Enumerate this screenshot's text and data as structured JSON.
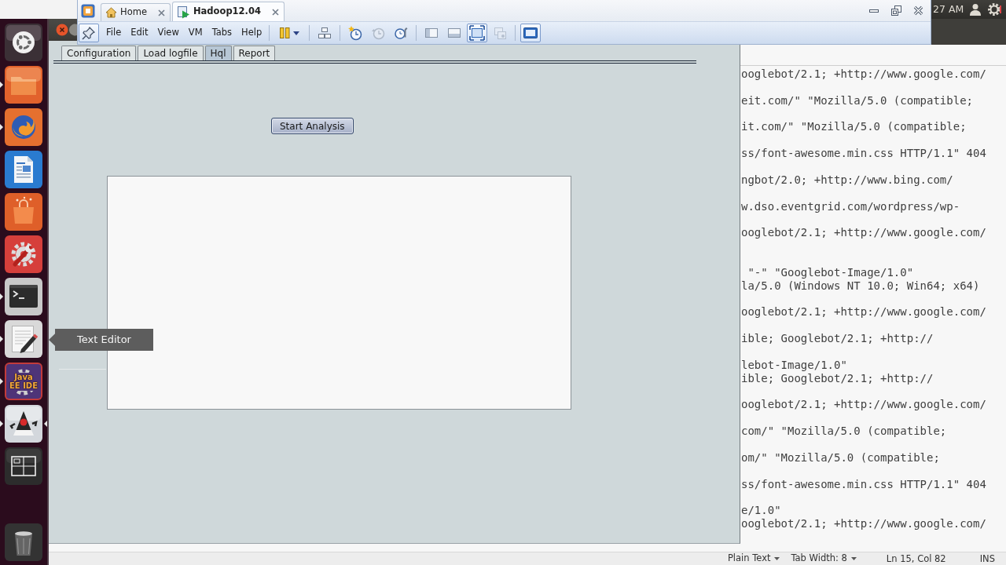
{
  "vm_window": {
    "tabs": [
      {
        "label": "Home",
        "selected": false
      },
      {
        "label": "Hadoop12.04",
        "selected": true
      }
    ],
    "pin_button": {
      "pressed": true
    },
    "menus": [
      "File",
      "Edit",
      "View",
      "VM",
      "Tabs",
      "Help"
    ],
    "toolbar_buttons": [
      {
        "pressed": false,
        "disabled": false
      },
      {
        "pressed": false,
        "disabled": false
      },
      {
        "pressed": false,
        "disabled": false
      },
      {
        "pressed": false,
        "disabled": true
      },
      {
        "pressed": false,
        "disabled": false
      },
      {
        "pressed": false,
        "disabled": false
      },
      {
        "pressed": false,
        "disabled": false
      },
      {
        "pressed": true,
        "disabled": false
      },
      {
        "pressed": false,
        "disabled": true
      },
      {
        "pressed": true,
        "disabled": false
      }
    ]
  },
  "top_panel": {
    "clock": "27 AM"
  },
  "launcher": {
    "items": [
      {
        "running": false,
        "active": false
      },
      {
        "running": true,
        "active": false
      },
      {
        "running": true,
        "active": false
      },
      {
        "running": false,
        "active": false
      },
      {
        "running": false,
        "active": false
      },
      {
        "running": false,
        "active": false
      },
      {
        "running": true,
        "active": false
      },
      {
        "running": true,
        "active": false
      },
      {
        "running": true,
        "active": false,
        "icon_text": "Java EE IDE"
      },
      {
        "running": true,
        "active": true
      },
      {
        "running": false,
        "active": false
      },
      {
        "running": false,
        "active": false
      }
    ],
    "tooltip": "Text Editor"
  },
  "app_window": {
    "tabs": [
      {
        "label": "Configuration",
        "selected": false
      },
      {
        "label": "Load logfile",
        "selected": false
      },
      {
        "label": "Hql",
        "selected": true
      },
      {
        "label": "Report",
        "selected": false
      }
    ],
    "start_button": "Start Analysis"
  },
  "editor": {
    "rows": [
      {
        "kind": "text",
        "text": "ooglebot/2.1; +http://www.google.com/"
      },
      {
        "kind": "blank"
      },
      {
        "kind": "text",
        "text": "eit.com/\" \"Mozilla/5.0 (compatible;"
      },
      {
        "kind": "blank"
      },
      {
        "kind": "text",
        "text": "it.com/\" \"Mozilla/5.0 (compatible;"
      },
      {
        "kind": "blank"
      },
      {
        "kind": "text",
        "text": "ss/font-awesome.min.css HTTP/1.1\" 404"
      },
      {
        "kind": "blank"
      },
      {
        "kind": "text",
        "text": "ngbot/2.0; +http://www.bing.com/"
      },
      {
        "kind": "blank"
      },
      {
        "kind": "text",
        "text": "w.dso.eventgrid.com/wordpress/wp-"
      },
      {
        "kind": "blank"
      },
      {
        "kind": "text",
        "text": "ooglebot/2.1; +http://www.google.com/"
      },
      {
        "kind": "blank"
      },
      {
        "kind": "blank"
      },
      {
        "kind": "text",
        "text": " \"-\" \"Googlebot-Image/1.0\""
      },
      {
        "kind": "text",
        "text": "la/5.0 (Windows NT 10.0; Win64; x64)"
      },
      {
        "kind": "blank"
      },
      {
        "kind": "text",
        "text": "ooglebot/2.1; +http://www.google.com/"
      },
      {
        "kind": "blank"
      },
      {
        "kind": "text",
        "text": "ible; Googlebot/2.1; +http://"
      },
      {
        "kind": "blank"
      },
      {
        "kind": "text",
        "text": "lebot-Image/1.0\""
      },
      {
        "kind": "text",
        "text": "ible; Googlebot/2.1; +http://"
      },
      {
        "kind": "blank"
      },
      {
        "kind": "text",
        "text": "ooglebot/2.1; +http://www.google.com/"
      },
      {
        "kind": "blank"
      },
      {
        "kind": "text",
        "text": "com/\" \"Mozilla/5.0 (compatible;"
      },
      {
        "kind": "blank"
      },
      {
        "kind": "text",
        "text": "om/\" \"Mozilla/5.0 (compatible;"
      },
      {
        "kind": "blank"
      },
      {
        "kind": "text",
        "text": "ss/font-awesome.min.css HTTP/1.1\" 404"
      },
      {
        "kind": "blank"
      },
      {
        "kind": "text",
        "text": "e/1.0\""
      },
      {
        "kind": "text",
        "text": "ooglebot/2.1; +http://www.google.com/"
      }
    ],
    "status_bar": {
      "language": "Plain Text",
      "tab_width": "Tab Width: 8",
      "cursor_position": "Ln 15, Col 82",
      "insert_mode": "INS"
    }
  }
}
